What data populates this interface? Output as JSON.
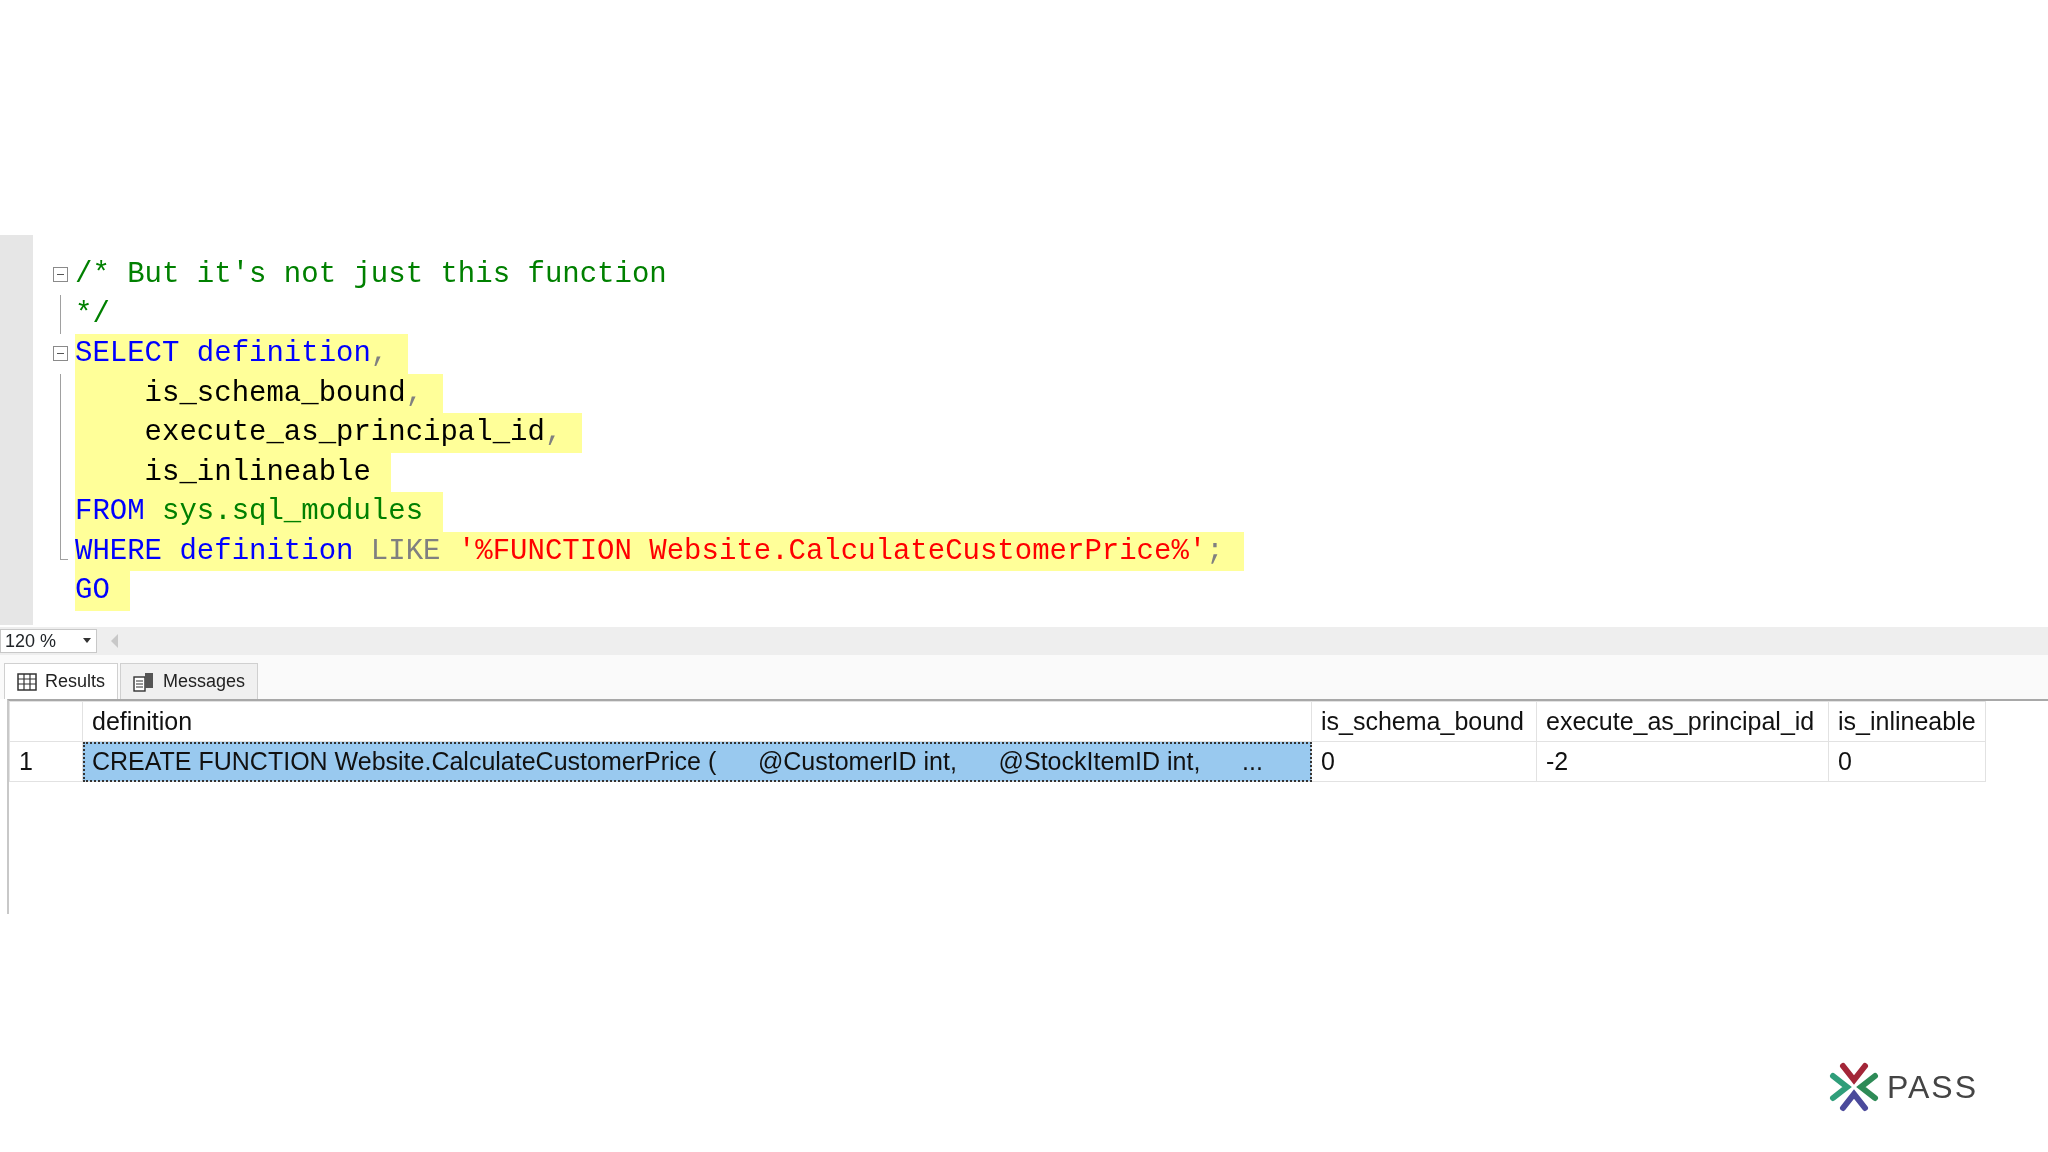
{
  "editor": {
    "lines": [
      {
        "collapsible": true,
        "in_region": false,
        "highlighted": false,
        "tokens": [
          {
            "kind": "comment",
            "text": "/* But it's not just this function"
          }
        ]
      },
      {
        "collapsible": false,
        "in_region": true,
        "highlighted": false,
        "tokens": [
          {
            "kind": "comment",
            "text": "*/"
          }
        ]
      },
      {
        "collapsible": true,
        "in_region": false,
        "highlighted": true,
        "tokens": [
          {
            "kind": "keyword",
            "text": "SELECT definition"
          },
          {
            "kind": "operator",
            "text": ","
          }
        ]
      },
      {
        "collapsible": false,
        "in_region": true,
        "highlighted": true,
        "tokens": [
          {
            "kind": "plain",
            "text": "    is_schema_bound"
          },
          {
            "kind": "operator",
            "text": ","
          }
        ]
      },
      {
        "collapsible": false,
        "in_region": true,
        "highlighted": true,
        "tokens": [
          {
            "kind": "plain",
            "text": "    execute_as_principal_id"
          },
          {
            "kind": "operator",
            "text": ","
          }
        ]
      },
      {
        "collapsible": false,
        "in_region": true,
        "highlighted": true,
        "tokens": [
          {
            "kind": "plain",
            "text": "    is_inlineable"
          }
        ]
      },
      {
        "collapsible": false,
        "in_region": true,
        "highlighted": true,
        "tokens": [
          {
            "kind": "keyword",
            "text": "FROM "
          },
          {
            "kind": "system",
            "text": "sys.sql_modules"
          }
        ]
      },
      {
        "collapsible": false,
        "in_region": true,
        "highlighted": true,
        "tokens": [
          {
            "kind": "keyword",
            "text": "WHERE definition "
          },
          {
            "kind": "operator",
            "text": "LIKE "
          },
          {
            "kind": "string",
            "text": "'%FUNCTION Website.CalculateCustomerPrice%'"
          },
          {
            "kind": "operator",
            "text": ";"
          }
        ]
      },
      {
        "collapsible": false,
        "in_region": false,
        "highlighted": true,
        "tokens": [
          {
            "kind": "keyword",
            "text": "GO"
          }
        ]
      }
    ]
  },
  "zoom": {
    "value": "120 %"
  },
  "tabs": [
    {
      "label": "Results",
      "kind": "grid",
      "selected": true
    },
    {
      "label": "Messages",
      "kind": "messages",
      "selected": false
    }
  ],
  "results": {
    "columns": [
      "definition",
      "is_schema_bound",
      "execute_as_principal_id",
      "is_inlineable"
    ],
    "rows": [
      {
        "number": "1",
        "selected": true,
        "cells": [
          "CREATE FUNCTION Website.CalculateCustomerPrice (      @CustomerID int,      @StockItemID int,      ...",
          "0",
          "-2",
          "0"
        ]
      }
    ]
  },
  "logo": {
    "text": "PASS"
  }
}
